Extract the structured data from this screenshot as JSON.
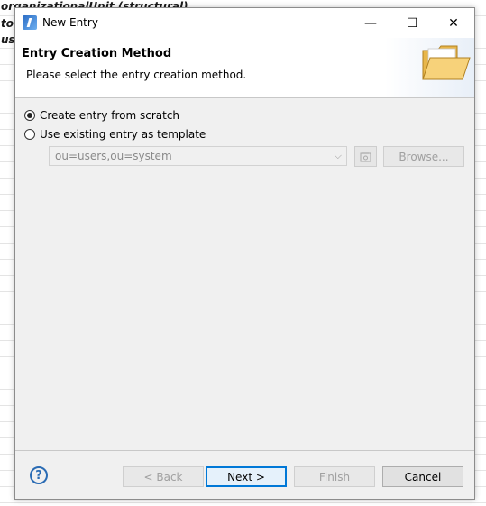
{
  "background": {
    "lines": [
      "organizationalUnit (structural)",
      "top",
      "use"
    ]
  },
  "window": {
    "title": "New Entry",
    "minimize_glyph": "—",
    "maximize_glyph": "☐",
    "close_glyph": "✕"
  },
  "header": {
    "title": "Entry Creation Method",
    "description": "Please select the entry creation method.",
    "icon": "folder-icon"
  },
  "options": [
    {
      "label": "Create entry from scratch",
      "checked": true
    },
    {
      "label": "Use existing entry as template",
      "checked": false
    }
  ],
  "template": {
    "value": "ou=users,ou=system",
    "arrow": "⌵",
    "browse_label": "Browse..."
  },
  "footer": {
    "help_glyph": "?",
    "back_label": "< Back",
    "next_label": "Next >",
    "finish_label": "Finish",
    "cancel_label": "Cancel"
  },
  "colors": {
    "accent": "#0078d7",
    "dialog_bg": "#f0f0f0"
  }
}
